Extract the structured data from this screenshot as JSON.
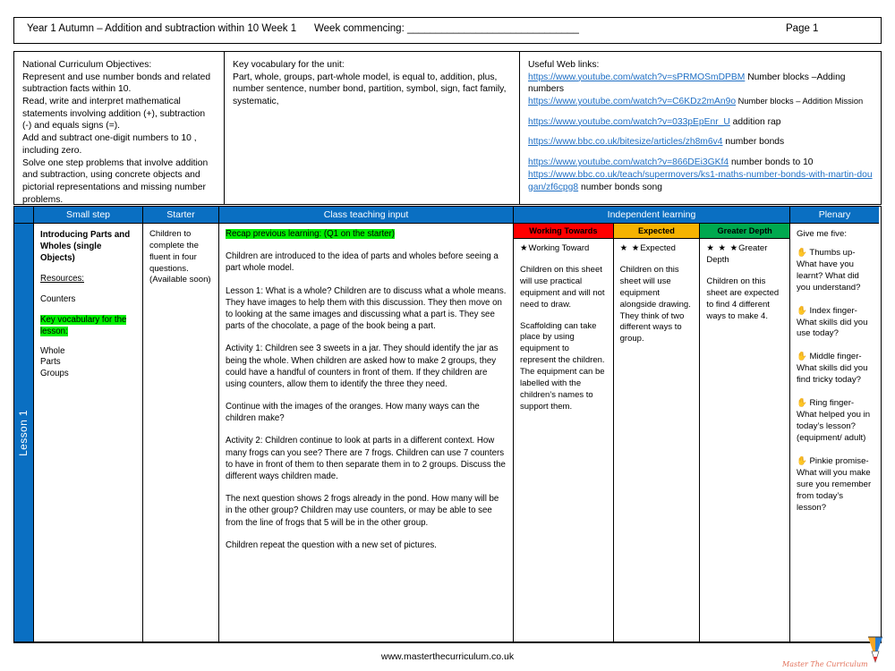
{
  "title_bar": {
    "unit": "Year 1 Autumn – Addition and subtraction within 10 Week 1",
    "week_commencing": "Week commencing: ______________________________",
    "page": "Page 1"
  },
  "info": {
    "nc_heading": "National Curriculum Objectives:",
    "nc_body": "Represent and use number bonds and related subtraction facts within 10.\nRead, write and interpret mathematical statements involving addition (+), subtraction (-) and equals signs (=).\nAdd and subtract one-digit numbers to 10 , including zero.\nSolve one step problems that involve addition and subtraction, using concrete objects and pictorial representations and missing number problems.",
    "vocab_heading": "Key vocabulary for the unit:",
    "vocab_body": "Part, whole, groups,  part-whole model, is equal to, addition, plus, number sentence, number bond, partition, symbol, sign, fact family, systematic,",
    "links_heading": "Useful Web links:",
    "links": [
      {
        "url": "https://www.youtube.com/watch?v=sPRMOSmDPBM",
        "label": " Number blocks –Adding numbers",
        "small": false
      },
      {
        "url": "https://www.youtube.com/watch?v=C6KDz2mAn9o",
        "label": " Number blocks – Addition Mission",
        "small": true
      },
      {
        "url": "https://www.youtube.com/watch?v=033pEpEnr_U",
        "label": "  addition rap",
        "small": false
      },
      {
        "url": "https://www.bbc.co.uk/bitesize/articles/zh8m6v4",
        "label": " number bonds",
        "small": false
      },
      {
        "url": "https://www.youtube.com/watch?v=866DEi3GKf4",
        "label": " number bonds to 10",
        "small": false
      },
      {
        "url": "https://www.bbc.co.uk/teach/supermovers/ks1-maths-number-bonds-with-martin-dougan/zf6cpg8",
        "label": " number bonds song",
        "small": false
      }
    ]
  },
  "table": {
    "headers": {
      "lesson": "",
      "small_step": "Small step",
      "starter": "Starter",
      "class_teaching": "Class teaching input",
      "independent": "Independent learning",
      "plenary": "Plenary"
    },
    "bands": {
      "working_towards": "Working Towards",
      "expected": "Expected",
      "greater_depth": "Greater Depth"
    },
    "band_colors": {
      "working_towards": "#ff0000",
      "expected": "#f5b301",
      "greater_depth": "#00a94f",
      "header": "#0a6fc2",
      "highlight": "#00f000"
    },
    "lesson_label": "Lesson 1",
    "small_step": {
      "title": "Introducing Parts and Wholes (single Objects)",
      "resources_heading": "Resources:",
      "resources": "Counters",
      "vocab_heading": "Key vocabulary for the lesson:",
      "vocab_items": [
        "Whole",
        "Parts",
        "Groups"
      ]
    },
    "starter": "Children to complete the fluent in four questions. (Available soon)",
    "class_teaching": {
      "recap": "Recap previous learning: (Q1 on the starter)",
      "paragraphs": [
        "Children are introduced to the idea of parts and wholes before seeing a part whole model.",
        "Lesson 1: What is a whole? Children are to discuss what a whole means. They have images to help them with this discussion. They then move on to looking at the same images and discussing what a part is. They see parts of the chocolate, a page of the book being a part.",
        "Activity 1: Children see 3 sweets in a jar. They should identify the jar as being the whole. When children are asked how to make 2 groups, they could have a handful of counters in front of them. If they children are using counters, allow them to identify the three they need.",
        "Continue with the images of the oranges. How many ways can the children make?",
        "Activity 2:  Children continue to look at parts in a different context. How many frogs can you see? There are 7 frogs. Children can use 7 counters to have in front of them to then separate them in to 2 groups. Discuss the different ways children made.",
        "The next question shows 2 frogs already in the pond. How many will be in the other group? Children may use counters, or may be able to see from the line of frogs that 5 will be in the other group.",
        "Children repeat the question with a new set of pictures."
      ]
    },
    "independent": {
      "working_towards": {
        "stars": "★",
        "label": "Working Toward",
        "paragraphs": [
          "Children on this sheet will use practical equipment and will not need to draw.",
          "Scaffolding can take place by using equipment to represent the children. The equipment can be labelled with the children’s names to support them."
        ]
      },
      "expected": {
        "stars": "★ ★",
        "label": "Expected",
        "paragraphs": [
          "Children on this sheet will use equipment alongside drawing. They think of two different  ways to group."
        ]
      },
      "greater_depth": {
        "stars": "★ ★ ★",
        "label": "Greater Depth",
        "paragraphs": [
          "Children on this sheet are expected to find 4 different ways to make 4."
        ]
      }
    },
    "plenary": {
      "title": "Give me five:",
      "items": [
        {
          "hand": "✋",
          "text": " Thumbs up- What have you learnt? What did you understand?"
        },
        {
          "hand": "✋",
          "text": " Index finger- What skills did you use today?"
        },
        {
          "hand": "✋",
          "text": " Middle finger- What skills did you find tricky today?"
        },
        {
          "hand": "✋",
          "text": " Ring finger- What helped you in today’s lesson? (equipment/ adult)"
        },
        {
          "hand": "✋",
          "text": " Pinkie promise- What will you make sure you remember from today’s lesson?"
        }
      ]
    }
  },
  "footer": {
    "url": "www.masterthecurriculum.co.uk",
    "logo_text": "Master The Curriculum"
  }
}
